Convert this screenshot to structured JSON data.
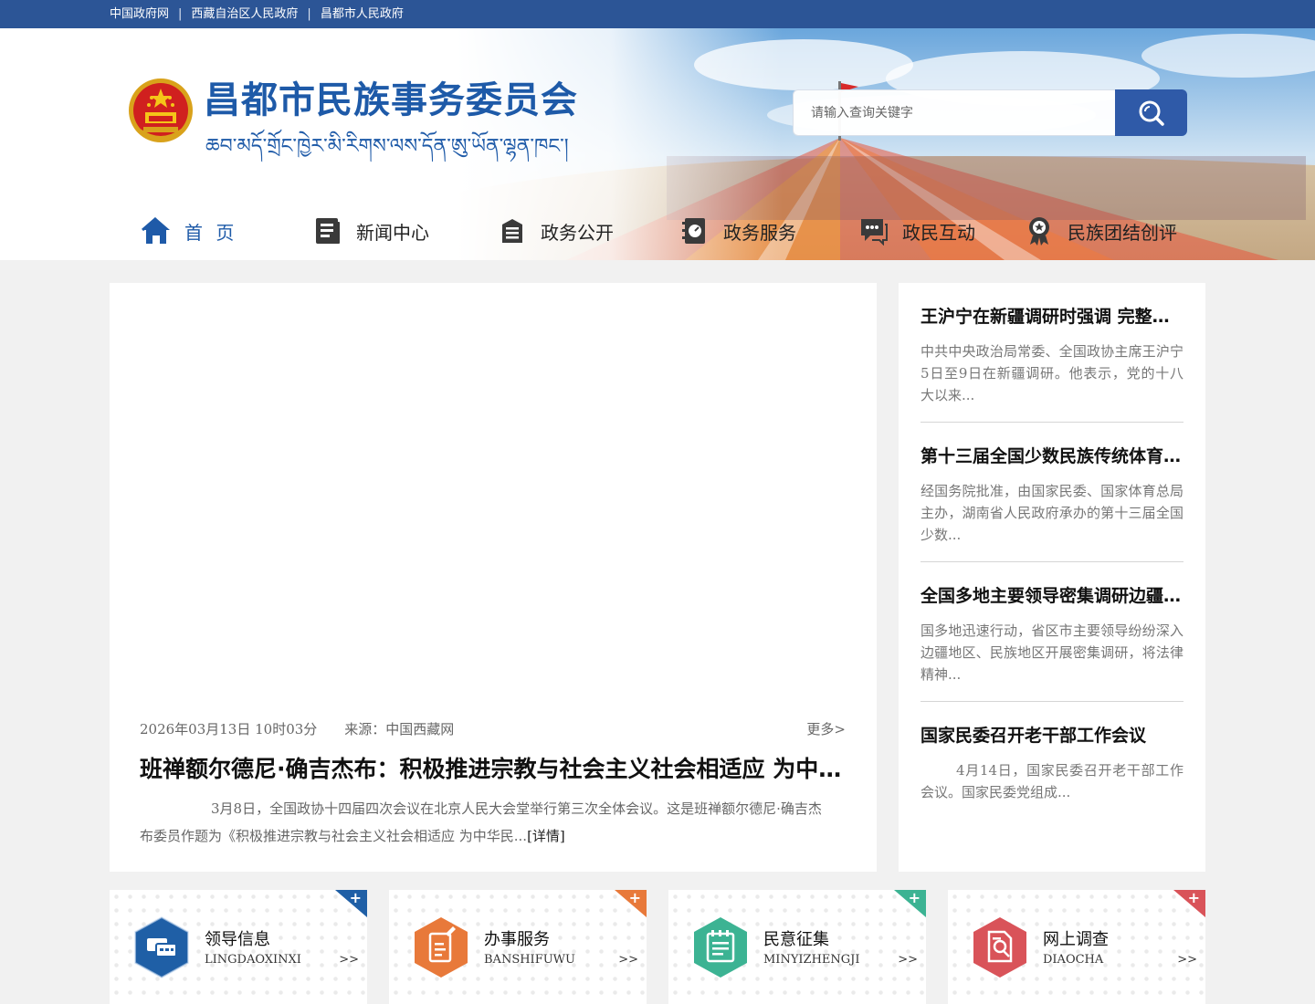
{
  "top_links": [
    "中国政府网",
    "西藏自治区人民政府",
    "昌都市人民政府"
  ],
  "header": {
    "title": "昌都市民族事务委员会",
    "subtitle_tibetan": "ཆབ་མདོ་གྲོང་ཁྱེར་མི་རིགས་ལས་དོན་ཨུ་ཡོན་ལྷན་ཁང་།"
  },
  "search": {
    "placeholder": "请输入查询关键字"
  },
  "nav": [
    {
      "label": "首 页",
      "icon": "home-icon"
    },
    {
      "label": "新闻中心",
      "icon": "news-icon"
    },
    {
      "label": "政务公开",
      "icon": "document-icon"
    },
    {
      "label": "政务服务",
      "icon": "service-icon"
    },
    {
      "label": "政民互动",
      "icon": "chat-icon"
    },
    {
      "label": "民族团结创评",
      "icon": "award-icon"
    }
  ],
  "feature": {
    "date": "2026年03月13日 10时03分",
    "source": "来源：中国西藏网",
    "more": "更多>",
    "headline": "班禅额尔德尼·确吉杰布：积极推进宗教与社会主义社会相适应 为中华民族伟大复兴贡献力量",
    "summary": "3月8日，全国政协十四届四次会议在北京人民大会堂举行第三次全体会议。这是班禅额尔德尼·确吉杰布委员作题为《积极推进宗教与社会主义社会相适应 为中华民...",
    "detail_link": "[详情]"
  },
  "news": [
    {
      "title": "王沪宁在新疆调研时强调 完整准确全面贯彻新时代党的治疆方略",
      "desc": "中共中央政治局常委、全国政协主席王沪宁5日至9日在新疆调研。他表示，党的十八大以来..."
    },
    {
      "title": "第十三届全国少数民族传统体育运动会",
      "desc": "经国务院批准，由国家民委、国家体育总局主办，湖南省人民政府承办的第十三届全国少数..."
    },
    {
      "title": "全国多地主要领导密集调研边疆民族地区",
      "desc": "国多地迅速行动，省区市主要领导纷纷深入边疆地区、民族地区开展密集调研，将法律精神..."
    },
    {
      "title": "国家民委召开老干部工作会议",
      "desc": "4月14日，国家民委召开老干部工作会议。国家民委党组成..."
    }
  ],
  "cards": [
    {
      "title": "领导信息",
      "sub": "LINGDAOXINXI",
      "arrow": ">>",
      "plus": "+",
      "color": "#1f5fa6",
      "icon": "leader-info-icon"
    },
    {
      "title": "办事服务",
      "sub": "BANSHIFUWU",
      "arrow": ">>",
      "plus": "+",
      "color": "#e8793a",
      "icon": "service-form-icon"
    },
    {
      "title": "民意征集",
      "sub": "MINYIZHENGJI",
      "arrow": ">>",
      "plus": "+",
      "color": "#3cb393",
      "icon": "opinion-collect-icon"
    },
    {
      "title": "网上调查",
      "sub": "DIAOCHA",
      "arrow": ">>",
      "plus": "+",
      "color": "#d95359",
      "icon": "survey-icon"
    }
  ]
}
